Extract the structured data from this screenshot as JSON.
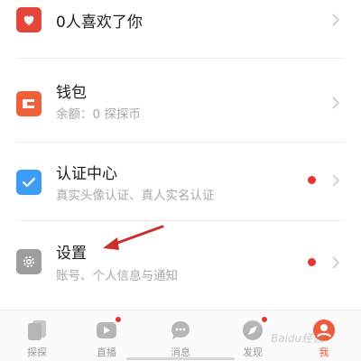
{
  "colors": {
    "heart_icon_bg": "#e5473d",
    "wallet_icon_bg": "#f0603a",
    "verify_icon_bg": "#3d9df5",
    "settings_icon_bg": "#9d9d9d",
    "badge_red": "#e8332e",
    "arrow_red": "#c9302c",
    "active_tab": "#ef5a3a"
  },
  "menu": {
    "likes": {
      "title": "0人喜欢了你",
      "icon": "heart-icon"
    },
    "wallet": {
      "title": "钱包",
      "subtitle": "余额：0 探探币",
      "icon": "wallet-icon"
    },
    "verify": {
      "title": "认证中心",
      "subtitle": "真实头像认证、真人实名认证",
      "icon": "checkbox-icon"
    },
    "settings": {
      "title": "设置",
      "subtitle": "账号、个人信息与通知",
      "icon": "gear-icon"
    }
  },
  "tabbar": {
    "tabs": [
      {
        "label": "探探",
        "icon": "cards-icon"
      },
      {
        "label": "直播",
        "icon": "live-play-icon"
      },
      {
        "label": "消息",
        "icon": "chat-bubble-icon"
      },
      {
        "label": "发现",
        "icon": "compass-icon"
      },
      {
        "label": "我",
        "icon": "profile-icon"
      }
    ]
  },
  "watermark": "Baidu经验"
}
